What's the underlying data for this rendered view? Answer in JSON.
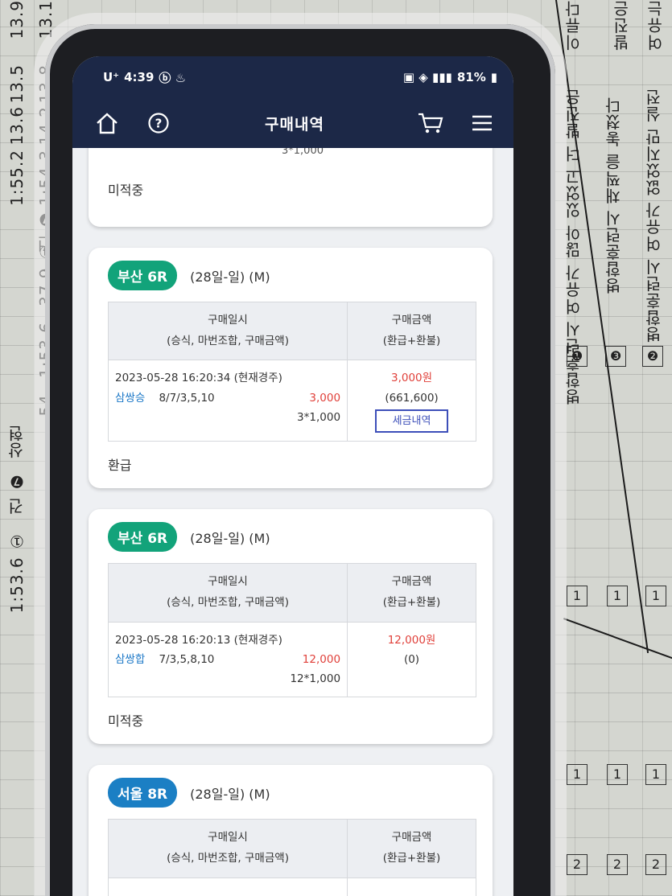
{
  "status_bar": {
    "carrier": "U⁺",
    "time": "4:39",
    "battery": "81%"
  },
  "app_bar": {
    "title": "구매내역"
  },
  "top_partial": {
    "detail_line": "3*1,000",
    "status": "미적중"
  },
  "table_headers": {
    "left_line1": "구매일시",
    "left_line2": "(승식, 마번조합, 구매금액)",
    "right_line1": "구매금액",
    "right_line2": "(환급+환불)"
  },
  "cards": [
    {
      "badge": "부산 6R",
      "badge_color": "#12a37a",
      "date": "(28일-일) (M)",
      "datetime": "2023-05-28 16:20:34 (현재경주)",
      "bet_type": "삼쌍승",
      "combination": "8/7/3,5,10",
      "amount": "3,000",
      "unit_line": "3*1,000",
      "purchase_amount": "3,000원",
      "refund": "(661,600)",
      "tax_button": "세금내역",
      "status": "환급"
    },
    {
      "badge": "부산 6R",
      "badge_color": "#12a37a",
      "date": "(28일-일) (M)",
      "datetime": "2023-05-28 16:20:13 (현재경주)",
      "bet_type": "삼쌍합",
      "combination": "7/3,5,8,10",
      "amount": "12,000",
      "unit_line": "12*1,000",
      "purchase_amount": "12,000원",
      "refund": "(0)",
      "status": "미적중"
    },
    {
      "badge": "서울 8R",
      "badge_color": "#1b7fc4",
      "date": "(28일-일) (M)"
    }
  ],
  "icons": {
    "home": "home-icon",
    "help": "help-icon",
    "cart": "cart-icon",
    "menu": "menu-icon"
  }
}
